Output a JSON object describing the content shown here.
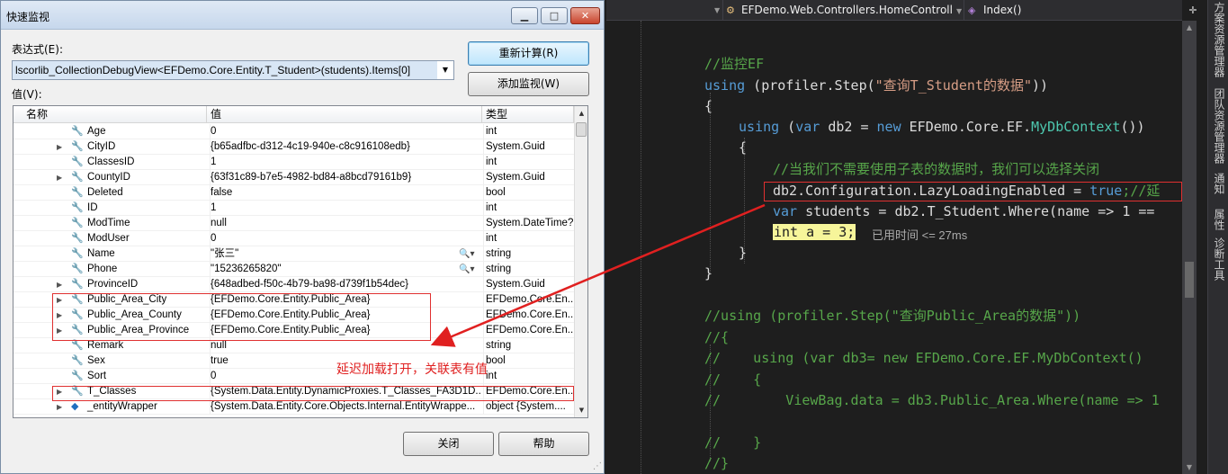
{
  "dialog": {
    "title": "快速监视",
    "expr_label": "表达式(E):",
    "expr_value": "lscorlib_CollectionDebugView<EFDemo.Core.Entity.T_Student>(students).Items[0]",
    "value_label": "值(V):",
    "recalc_button": "重新计算(R)",
    "add_watch_button": "添加监视(W)",
    "close_button": "关闭",
    "help_button": "帮助",
    "columns": {
      "name": "名称",
      "value": "值",
      "type": "类型"
    },
    "rows": [
      {
        "name": "Age",
        "value": "0",
        "type": "int",
        "expandable": false,
        "icon": "wrench"
      },
      {
        "name": "CityID",
        "value": "{b65adfbc-d312-4c19-940e-c8c916108edb}",
        "type": "System.Guid",
        "expandable": true,
        "icon": "wrench"
      },
      {
        "name": "ClassesID",
        "value": "1",
        "type": "int",
        "expandable": false,
        "icon": "wrench"
      },
      {
        "name": "CountyID",
        "value": "{63f31c89-b7e5-4982-bd84-a8bcd79161b9}",
        "type": "System.Guid",
        "expandable": true,
        "icon": "wrench"
      },
      {
        "name": "Deleted",
        "value": "false",
        "type": "bool",
        "expandable": false,
        "icon": "wrench"
      },
      {
        "name": "ID",
        "value": "1",
        "type": "int",
        "expandable": false,
        "icon": "wrench"
      },
      {
        "name": "ModTime",
        "value": "null",
        "type": "System.DateTime?",
        "expandable": false,
        "icon": "wrench"
      },
      {
        "name": "ModUser",
        "value": "0",
        "type": "int",
        "expandable": false,
        "icon": "wrench"
      },
      {
        "name": "Name",
        "value": "\"张三\"",
        "type": "string",
        "expandable": false,
        "icon": "wrench",
        "magnifier": true
      },
      {
        "name": "Phone",
        "value": "\"15236265820\"",
        "type": "string",
        "expandable": false,
        "icon": "wrench",
        "magnifier": true
      },
      {
        "name": "ProvinceID",
        "value": "{648adbed-f50c-4b79-ba98-d739f1b54dec}",
        "type": "System.Guid",
        "expandable": true,
        "icon": "wrench"
      },
      {
        "name": "Public_Area_City",
        "value": "{EFDemo.Core.Entity.Public_Area}",
        "type": "EFDemo.Core.En...",
        "expandable": true,
        "icon": "wrench"
      },
      {
        "name": "Public_Area_County",
        "value": "{EFDemo.Core.Entity.Public_Area}",
        "type": "EFDemo.Core.En...",
        "expandable": true,
        "icon": "wrench"
      },
      {
        "name": "Public_Area_Province",
        "value": "{EFDemo.Core.Entity.Public_Area}",
        "type": "EFDemo.Core.En...",
        "expandable": true,
        "icon": "wrench"
      },
      {
        "name": "Remark",
        "value": "null",
        "type": "string",
        "expandable": false,
        "icon": "wrench"
      },
      {
        "name": "Sex",
        "value": "true",
        "type": "bool",
        "expandable": false,
        "icon": "wrench"
      },
      {
        "name": "Sort",
        "value": "0",
        "type": "int",
        "expandable": false,
        "icon": "wrench"
      },
      {
        "name": "T_Classes",
        "value": "{System.Data.Entity.DynamicProxies.T_Classes_FA3D1D...",
        "type": "EFDemo.Core.En...",
        "expandable": true,
        "icon": "wrench"
      },
      {
        "name": "_entityWrapper",
        "value": "{System.Data.Entity.Core.Objects.Internal.EntityWrappe...",
        "type": "object {System....",
        "expandable": true,
        "icon": "field"
      }
    ],
    "annotation": "延迟加载打开，关联表有值"
  },
  "editor": {
    "nav_mid": "EFDemo.Web.Controllers.HomeControll",
    "nav_right": "Index()",
    "code": {
      "l1": "//监控EF",
      "l2_kw": "using",
      "l2a": " (profiler.Step(",
      "l2_str": "\"查询T_Student的数据\"",
      "l2b": "))",
      "l3": "{",
      "l4_kw": "using",
      "l4a": " (",
      "l4_var": "var",
      "l4b": " db2 = ",
      "l4_new": "new",
      "l4c": " EFDemo.Core.EF.",
      "l4_type": "MyDbContext",
      "l4d": "())",
      "l5": "{",
      "l6": "//当我们不需要使用子表的数据时，我们可以选择关闭",
      "l7a": "db2.Configuration.LazyLoadingEnabled = ",
      "l7_true": "true",
      "l7_cm": ";//延",
      "l8_var": "var",
      "l8a": " students = db2.T_Student.Where(name => 1 ==",
      "l9": "int a = 3;",
      "l10": "}",
      "l11": "}",
      "l12": "//using (profiler.Step(\"查询Public_Area的数据\"))",
      "l13": "//{",
      "l14": "//    using (var db3= new EFDemo.Core.EF.MyDbContext()",
      "l15": "//    {",
      "l16": "//        ViewBag.data = db3.Public_Area.Where(name => 1",
      "l17": "//    }",
      "l18": "//}"
    },
    "elapsed": "已用时间 <= 27ms"
  },
  "tooltabs": [
    "方案资源管理器",
    "团队资源管理器",
    "通知",
    "属性",
    "诊断工具"
  ]
}
